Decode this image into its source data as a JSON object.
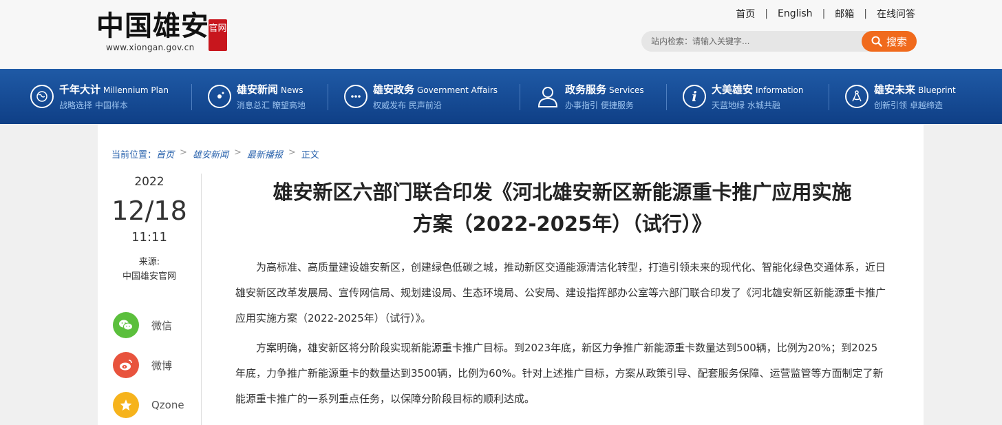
{
  "header": {
    "logo_text": "中国雄安",
    "logo_seal": "官网",
    "logo_url": "www.xiongan.gov.cn",
    "links": [
      "首页",
      "English",
      "邮箱",
      "在线问答"
    ],
    "search_placeholder": "站内检索：请输入关键字...",
    "search_button": "搜索"
  },
  "nav": [
    {
      "title": "千年大计",
      "en": "Millennium Plan",
      "sub": "战略选择 中国样本",
      "icon": "globe-icon"
    },
    {
      "title": "雄安新闻",
      "en": "News",
      "sub": "消息总汇 瞭望高地",
      "icon": "news-icon"
    },
    {
      "title": "雄安政务",
      "en": "Government Affairs",
      "sub": "权威发布 民声前沿",
      "icon": "chat-icon"
    },
    {
      "title": "政务服务",
      "en": "Services",
      "sub": "办事指引 便捷服务",
      "icon": "user-icon"
    },
    {
      "title": "大美雄安",
      "en": "Information",
      "sub": "天蓝地绿 水城共融",
      "icon": "info-icon"
    },
    {
      "title": "雄安未来",
      "en": "Blueprint",
      "sub": "创新引领 卓越缔造",
      "icon": "compass-icon"
    }
  ],
  "breadcrumb": {
    "label": "当前位置：",
    "items": [
      "首页",
      "雄安新闻",
      "最新播报"
    ],
    "current": "正文"
  },
  "meta": {
    "year": "2022",
    "date": "12/18",
    "time": "11:11",
    "source_label": "来源:",
    "source": "中国雄安官网"
  },
  "share": [
    {
      "label": "微信",
      "icon": "wechat-icon",
      "color": "#5bbf3c"
    },
    {
      "label": "微博",
      "icon": "weibo-icon",
      "color": "#e8533d"
    },
    {
      "label": "Qzone",
      "icon": "qzone-icon",
      "color": "#f6b31c"
    }
  ],
  "article": {
    "title_line1": "雄安新区六部门联合印发《河北雄安新区新能源重卡推广应用实施",
    "title_line2": "方案（2022-2025年）（试行）》",
    "paragraphs": [
      "为高标准、高质量建设雄安新区，创建绿色低碳之城，推动新区交通能源清洁化转型，打造引领未来的现代化、智能化绿色交通体系，近日雄安新区改革发展局、宣传网信局、规划建设局、生态环境局、公安局、建设指挥部办公室等六部门联合印发了《河北雄安新区新能源重卡推广应用实施方案（2022-2025年）（试行）》。",
      "方案明确，雄安新区将分阶段实现新能源重卡推广目标。到2023年底，新区力争推广新能源重卡数量达到500辆，比例为20%；到2025年底，力争推广新能源重卡的数量达到3500辆，比例为60%。针对上述推广目标，方案从政策引导、配套服务保障、运营监管等方面制定了新能源重卡推广的一系列重点任务，以保障分阶段目标的顺利达成。"
    ]
  }
}
